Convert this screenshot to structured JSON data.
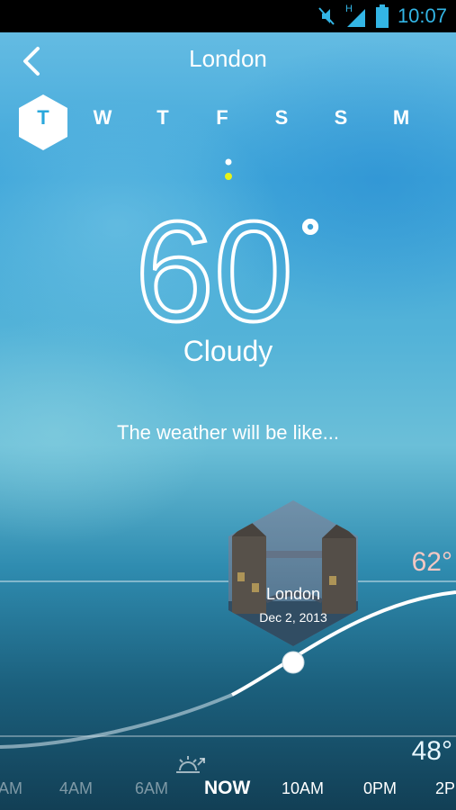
{
  "status_bar": {
    "time": "10:07",
    "network": "H",
    "icons": [
      "mute-icon",
      "signal-icon",
      "battery-icon"
    ]
  },
  "header": {
    "city": "London",
    "back_icon": "chevron-left-icon"
  },
  "days": [
    {
      "label": "T",
      "active": true
    },
    {
      "label": "W",
      "active": false
    },
    {
      "label": "T",
      "active": false
    },
    {
      "label": "F",
      "active": false
    },
    {
      "label": "S",
      "active": false
    },
    {
      "label": "S",
      "active": false
    },
    {
      "label": "M",
      "active": false
    }
  ],
  "current": {
    "temperature": "60",
    "degree": "°",
    "condition": "Cloudy",
    "forecast_text": "The weather will be like..."
  },
  "graph": {
    "high": "62°",
    "low": "48°",
    "photo_city": "London",
    "photo_date": "Dec 2, 2013",
    "sunrise_icon": "sunrise-icon"
  },
  "timeline": [
    {
      "label": "AM",
      "style": "dim"
    },
    {
      "label": "4AM",
      "style": "dim"
    },
    {
      "label": "6AM",
      "style": "dim"
    },
    {
      "label": "NOW",
      "style": "now"
    },
    {
      "label": "10AM",
      "style": "normal"
    },
    {
      "label": "0PM",
      "style": "normal"
    },
    {
      "label": "2P",
      "style": "normal"
    }
  ],
  "colors": {
    "accent_blue": "#33b5e5",
    "active_day_text": "#2aa8dc",
    "indicator_yellow": "#e6f21a",
    "high_temp": "#f3c7c3"
  }
}
